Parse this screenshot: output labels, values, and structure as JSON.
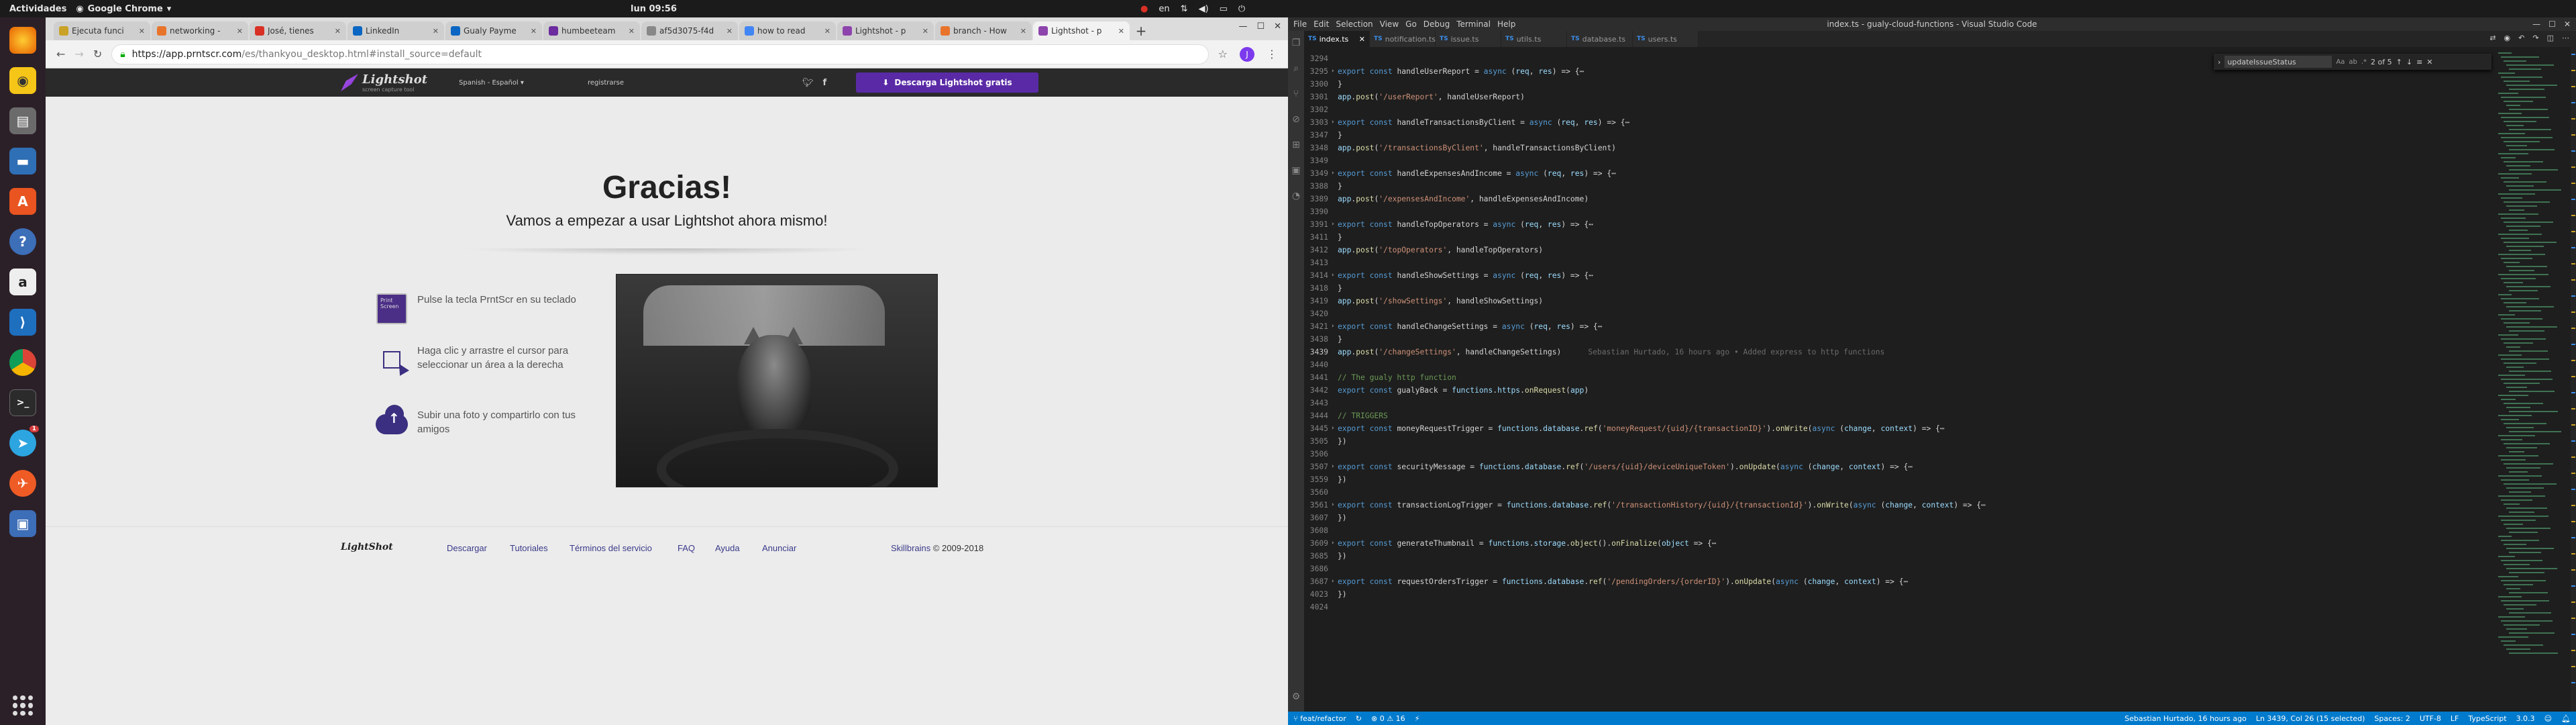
{
  "topbar": {
    "activities": "Actividades",
    "app": "Google Chrome",
    "clock": "lun 09:56",
    "lang": "en"
  },
  "chrome": {
    "tabs": [
      {
        "label": "Ejecuta funci",
        "color": "#c9a227"
      },
      {
        "label": "networking - ",
        "color": "#e8742c"
      },
      {
        "label": "José, tienes ",
        "color": "#d93025"
      },
      {
        "label": "LinkedIn",
        "color": "#0a66c2"
      },
      {
        "label": "Gualy Payme",
        "color": "#0a66c2"
      },
      {
        "label": "humbeeteam",
        "color": "#6c2b9e"
      },
      {
        "label": "af5d3075-f4d",
        "color": "#888"
      },
      {
        "label": "how to read",
        "color": "#4285f4"
      },
      {
        "label": "Lightshot - p",
        "color": "#8e44ad"
      },
      {
        "label": "branch - How",
        "color": "#e8742c"
      },
      {
        "label": "Lightshot - p",
        "color": "#8e44ad"
      }
    ],
    "new_tab": "+",
    "url_host": "https://app.prntscr.com",
    "url_path": "/es/thankyou_desktop.html#install_source=default",
    "profile_initial": "J"
  },
  "lightshot": {
    "brand": "Lightshot",
    "tagline": "screen capture tool",
    "language": "Spanish - Español",
    "register": "registrarse",
    "download_btn": "Descarga Lightshot gratis",
    "title": "Gracias!",
    "subtitle": "Vamos a empezar a usar Lightshot ahora mismo!",
    "steps": [
      {
        "icon": "keyboard-icon",
        "key": "Print Screen",
        "text": "Pulse la tecla PrntScr en su teclado"
      },
      {
        "icon": "select-area-icon",
        "text": "Haga clic y arrastre el cursor para seleccionar un área a la derecha"
      },
      {
        "icon": "cloud-upload-icon",
        "text": "Subir una foto y compartirlo con tus amigos"
      }
    ],
    "footer": {
      "logo": "LightShot",
      "links": [
        "Descargar",
        "Tutoriales",
        "Términos del servicio",
        "FAQ",
        "Ayuda",
        "Anunciar"
      ],
      "company": "Skillbrains",
      "copyright": " © 2009-2018"
    }
  },
  "vscode": {
    "window_title": "index.ts - gualy-cloud-functions - Visual Studio Code",
    "menu": [
      "File",
      "Edit",
      "Selection",
      "View",
      "Go",
      "Debug",
      "Terminal",
      "Help"
    ],
    "tabs": [
      "index.ts",
      "notification.ts",
      "issue.ts",
      "utils.ts",
      "database.ts",
      "users.ts"
    ],
    "find": {
      "value": "updateIssueStatus",
      "count": "2 of 5"
    },
    "blame": "Sebastian Hurtado, 16 hours ago • Added express to http functions",
    "lines": [
      [
        "3294",
        ""
      ],
      [
        "3295",
        "export const handleUserReport = async (req, res) => {⋯"
      ],
      [
        "3300",
        "}"
      ],
      [
        "3301",
        "app.post('/userReport', handleUserReport)"
      ],
      [
        "3302",
        ""
      ],
      [
        "3303",
        "export const handleTransactionsByClient = async (req, res) => {⋯"
      ],
      [
        "3347",
        "}"
      ],
      [
        "3348",
        "app.post('/transactionsByClient', handleTransactionsByClient)"
      ],
      [
        "3349",
        ""
      ],
      [
        "3349",
        "export const handleExpensesAndIncome = async (req, res) => {⋯"
      ],
      [
        "3388",
        "}"
      ],
      [
        "3389",
        "app.post('/expensesAndIncome', handleExpensesAndIncome)"
      ],
      [
        "3390",
        ""
      ],
      [
        "3391",
        "export const handleTopOperators = async (req, res) => {⋯"
      ],
      [
        "3411",
        "}"
      ],
      [
        "3412",
        "app.post('/topOperators', handleTopOperators)"
      ],
      [
        "3413",
        ""
      ],
      [
        "3414",
        "export const handleShowSettings = async (req, res) => {⋯"
      ],
      [
        "3418",
        "}"
      ],
      [
        "3419",
        "app.post('/showSettings', handleShowSettings)"
      ],
      [
        "3420",
        ""
      ],
      [
        "3421",
        "export const handleChangeSettings = async (req, res) => {⋯"
      ],
      [
        "3438",
        "}"
      ],
      [
        "3439",
        "app.post('/changeSettings', handleChangeSettings)"
      ],
      [
        "3440",
        ""
      ],
      [
        "3441",
        "// The gualy http function"
      ],
      [
        "3442",
        "export const gualyBack = functions.https.onRequest(app)"
      ],
      [
        "3443",
        ""
      ],
      [
        "3444",
        "// TRIGGERS"
      ],
      [
        "3445",
        "export const moneyRequestTrigger = functions.database.ref('moneyRequest/{uid}/{transactionID}').onWrite(async (change, context) => {⋯"
      ],
      [
        "3505",
        "})"
      ],
      [
        "3506",
        ""
      ],
      [
        "3507",
        "export const securityMessage = functions.database.ref('/users/{uid}/deviceUniqueToken').onUpdate(async (change, context) => {⋯"
      ],
      [
        "3559",
        "})"
      ],
      [
        "3560",
        ""
      ],
      [
        "3561",
        "export const transactionLogTrigger = functions.database.ref('/transactionHistory/{uid}/{transactionId}').onWrite(async (change, context) => {⋯"
      ],
      [
        "3607",
        "})"
      ],
      [
        "3608",
        ""
      ],
      [
        "3609",
        "export const generateThumbnail = functions.storage.object().onFinalize(object => {⋯"
      ],
      [
        "3685",
        "})"
      ],
      [
        "3686",
        ""
      ],
      [
        "3687",
        "export const requestOrdersTrigger = functions.database.ref('/pendingOrders/{orderID}').onUpdate(async (change, context) => {⋯"
      ],
      [
        "4023",
        "})"
      ],
      [
        "4024",
        ""
      ]
    ],
    "status": {
      "branch": "feat/refactor",
      "problems": "⊗ 0 ⚠ 16",
      "blame": "Sebastian Hurtado, 16 hours ago",
      "position": "Ln 3439, Col 26 (15 selected)",
      "spaces": "Spaces: 2",
      "encoding": "UTF-8",
      "eol": "LF",
      "language": "TypeScript",
      "version": "3.0.3"
    }
  }
}
